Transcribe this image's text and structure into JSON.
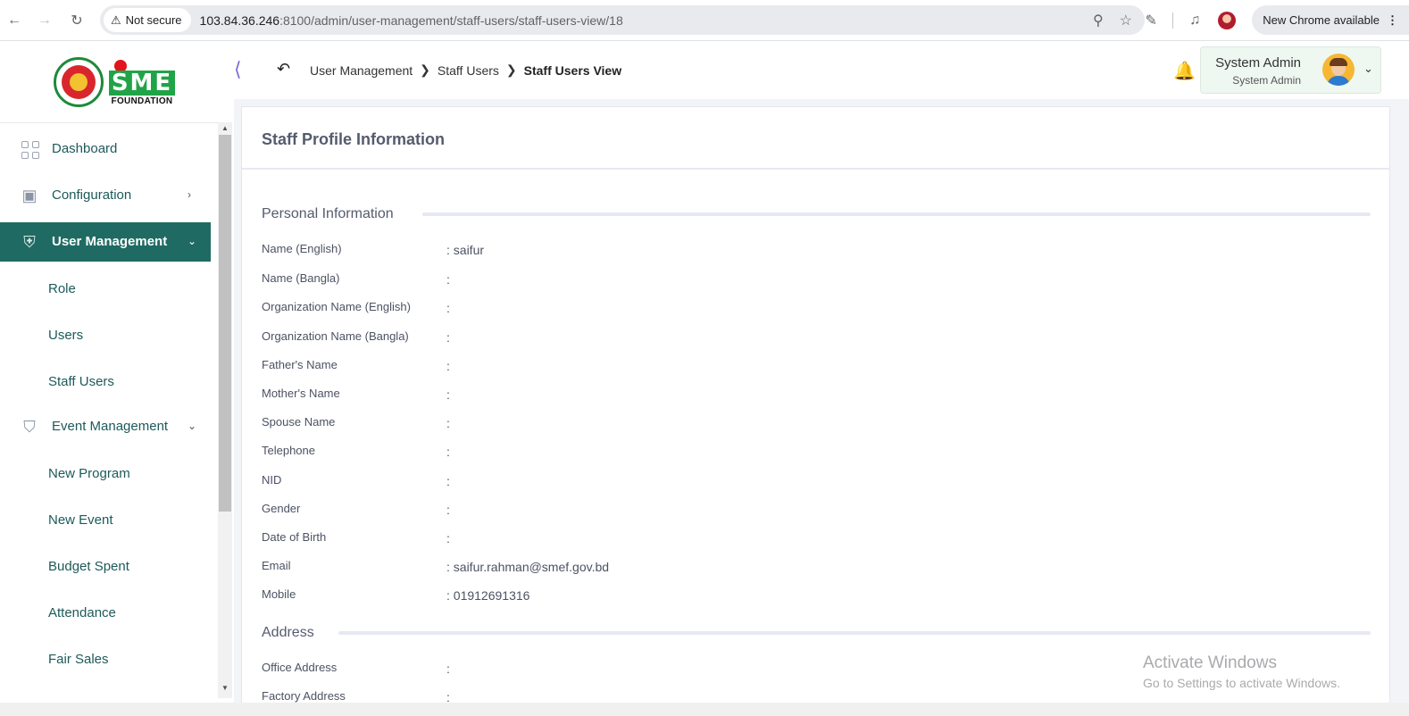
{
  "browser": {
    "security_label": "Not secure",
    "url_host": "103.84.36.246",
    "url_path": ":8100/admin/user-management/staff-users/staff-users-view/18",
    "new_chrome_label": "New Chrome available"
  },
  "logo": {
    "text": "SME",
    "subtext": "FOUNDATION"
  },
  "breadcrumb": {
    "items": [
      "User Management",
      "Staff Users"
    ],
    "current": "Staff Users View"
  },
  "user": {
    "name": "System Admin",
    "role": "System Admin"
  },
  "sidebar": {
    "items": [
      {
        "label": "Dashboard",
        "icon": "grid-icon"
      },
      {
        "label": "Configuration",
        "icon": "config-icon"
      },
      {
        "label": "User Management",
        "icon": "shield-icon",
        "active": true
      },
      {
        "label": "Event Management",
        "icon": "lock-icon"
      }
    ],
    "user_management_sub": [
      "Role",
      "Users",
      "Staff Users"
    ],
    "event_management_sub": [
      "New Program",
      "New Event",
      "Budget Spent",
      "Attendance",
      "Fair Sales"
    ]
  },
  "profile": {
    "title": "Staff Profile Information",
    "personal_heading": "Personal Information",
    "address_heading": "Address",
    "fields": [
      {
        "label": "Name (English)",
        "value": ": saifur"
      },
      {
        "label": "Name (Bangla)",
        "value": ":"
      },
      {
        "label": "Organization Name (English)",
        "value": ":"
      },
      {
        "label": "Organization Name (Bangla)",
        "value": ":"
      },
      {
        "label": "Father's Name",
        "value": ":"
      },
      {
        "label": "Mother's Name",
        "value": ":"
      },
      {
        "label": "Spouse Name",
        "value": ":"
      },
      {
        "label": "Telephone",
        "value": ":"
      },
      {
        "label": "NID",
        "value": ":"
      },
      {
        "label": "Gender",
        "value": ":"
      },
      {
        "label": "Date of Birth",
        "value": ":"
      },
      {
        "label": "Email",
        "value": ": saifur.rahman@smef.gov.bd"
      },
      {
        "label": "Mobile",
        "value": ": 01912691316"
      }
    ],
    "address_fields": [
      {
        "label": "Office Address",
        "value": ":"
      },
      {
        "label": "Factory Address",
        "value": ":"
      }
    ]
  },
  "watermark": {
    "title": "Activate Windows",
    "subtitle": "Go to Settings to activate Windows."
  },
  "colors": {
    "sidebar_active": "#1f6b63",
    "sidebar_text": "#1d5a5a",
    "logo_green": "#20a447",
    "logo_red": "#e3141b"
  }
}
